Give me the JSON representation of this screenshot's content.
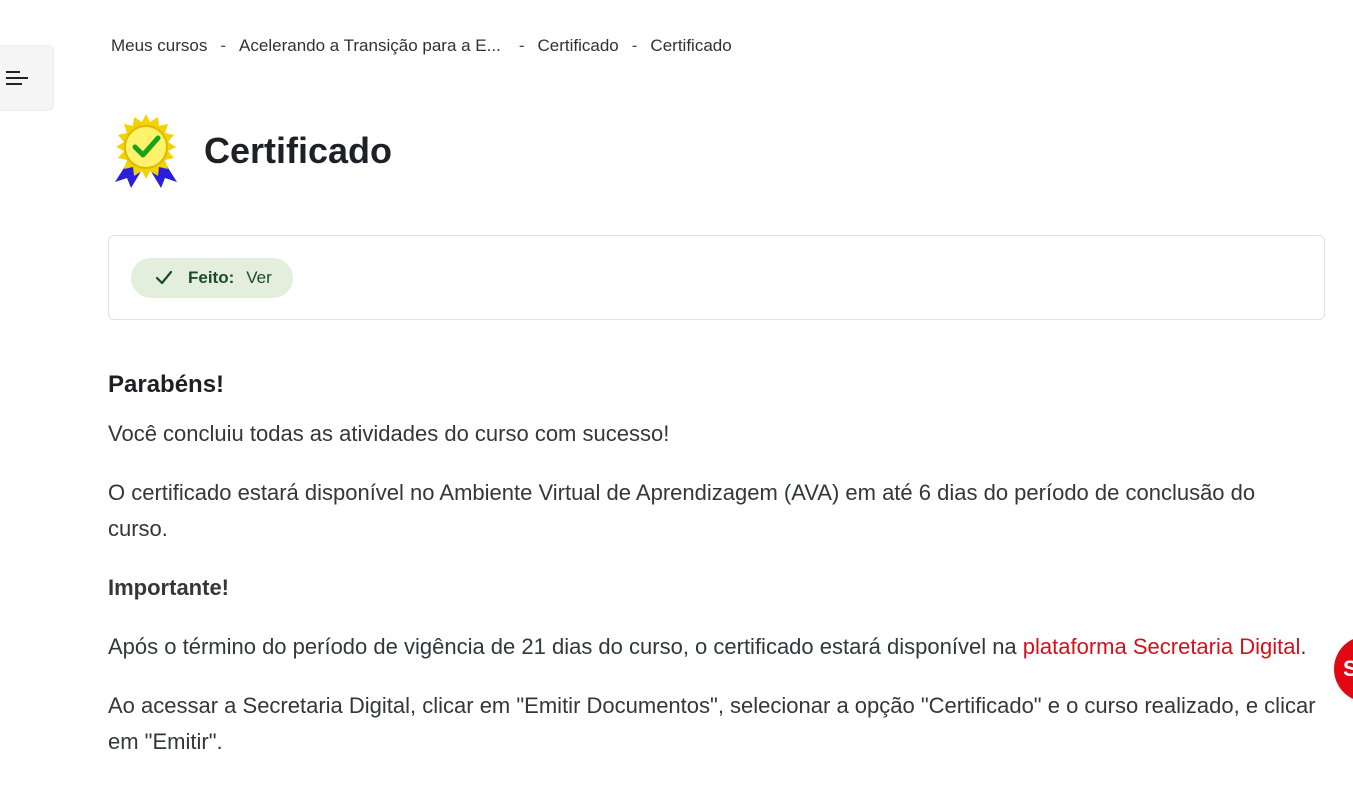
{
  "drawer": {
    "icon": "menu-lines-icon"
  },
  "breadcrumb": [
    {
      "label": "Meus cursos"
    },
    {
      "label": "Acelerando a Transição para a E..."
    },
    {
      "label": "Certificado"
    },
    {
      "label": "Certificado"
    }
  ],
  "breadcrumb_separator": "-",
  "page": {
    "title": "Certificado",
    "icon": "award-badge-icon"
  },
  "completion": {
    "icon": "checkmark-icon",
    "label": "Feito:",
    "value": "Ver",
    "colors": {
      "background": "#e3efdc",
      "text": "#1c4a2b"
    }
  },
  "content": {
    "heading": "Parabéns!",
    "p1": "Você concluiu todas as atividades do curso com sucesso!",
    "p2": "O certificado estará disponível no Ambiente Virtual de Aprendizagem (AVA) em até 6 dias do período de conclusão do curso.",
    "important": "Importante!",
    "p3_before": "Após o término do período de vigência de 21 dias do curso, o certificado estará disponível na ",
    "p3_link": "plataforma Secretaria Digital",
    "p3_after": ".",
    "p4": "Ao acessar a Secretaria Digital, clicar em \"Emitir Documentos\", selecionar a opção \"Certificado\" e o curso realizado, e clicar em \"Emitir\"."
  },
  "floating_button": {
    "label": "S",
    "color": "#e30613"
  },
  "colors": {
    "link": "#d4111a",
    "border": "#dee2e6"
  }
}
